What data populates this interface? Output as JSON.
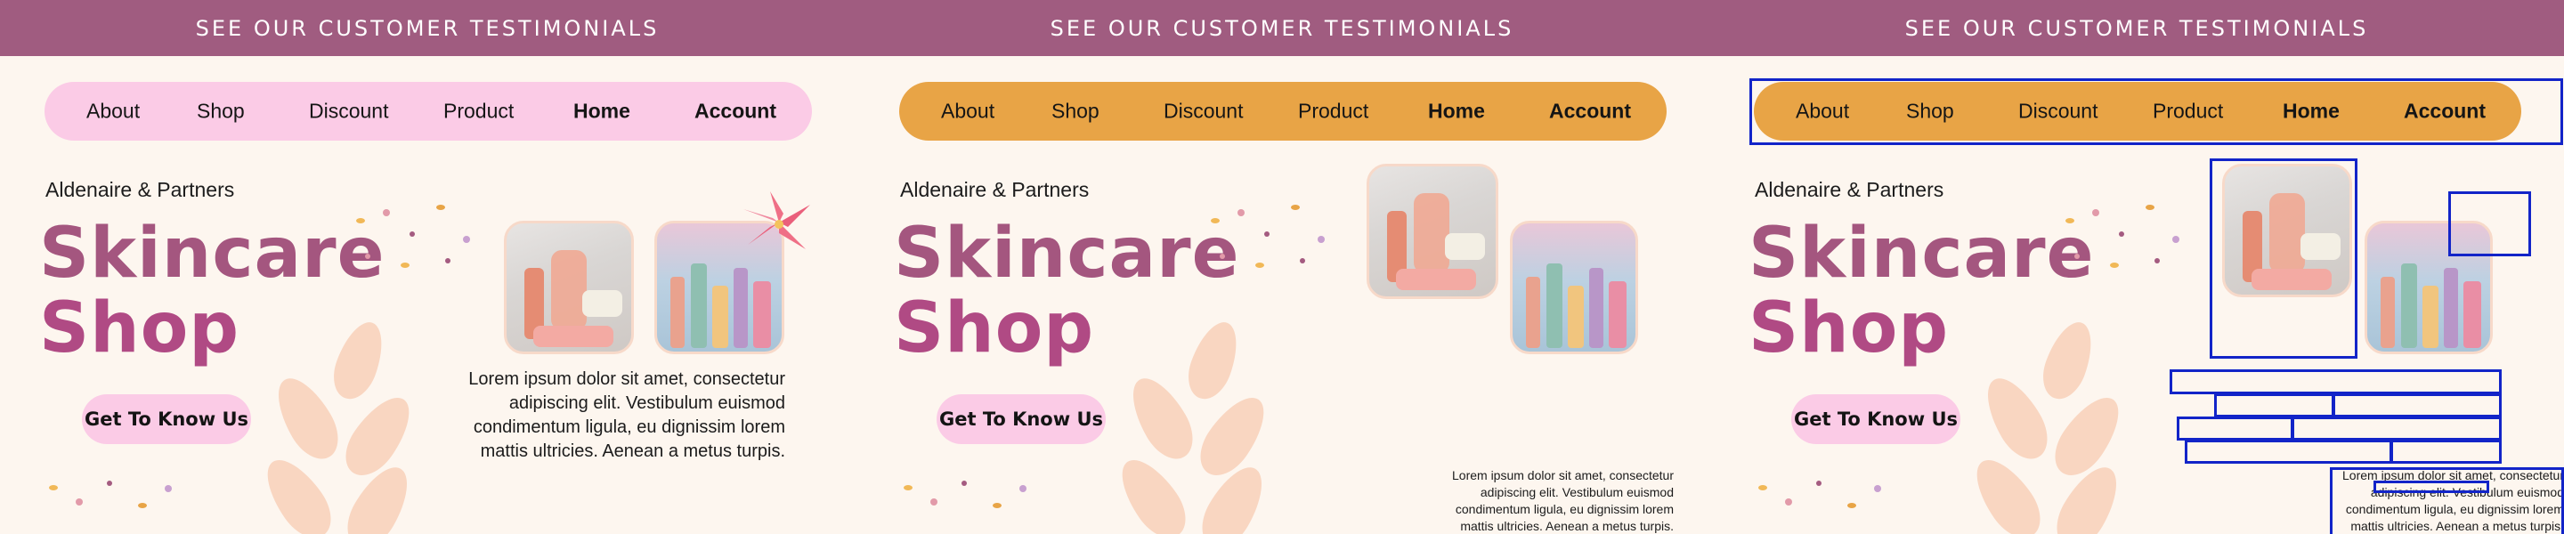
{
  "banner": {
    "text": "SEE OUR CUSTOMER TESTIMONIALS"
  },
  "nav": {
    "items": [
      {
        "label": "About"
      },
      {
        "label": "Shop"
      },
      {
        "label": "Discount"
      },
      {
        "label": "Product"
      },
      {
        "label": "Home"
      },
      {
        "label": "Account"
      }
    ]
  },
  "brand": "Aldenaire & Partners",
  "title": {
    "line1": "Skincare",
    "line2": "Shop"
  },
  "cta": "Get To Know Us",
  "description": {
    "line1": "Lorem ipsum dolor sit amet, consectetur",
    "line2": "adipiscing elit. Vestibulum euismod",
    "line3": "condimentum ligula, eu dignissim lorem",
    "line4": "mattis ultricies. Aenean a metus turpis."
  },
  "colors": {
    "banner": "#a05c80",
    "nav_pink": "#fbcbe6",
    "nav_orange": "#e8a446",
    "title_plum": "#a4567f",
    "overlay_box": "#1224c8"
  },
  "icons": {
    "flower": "pink-lily-icon"
  }
}
